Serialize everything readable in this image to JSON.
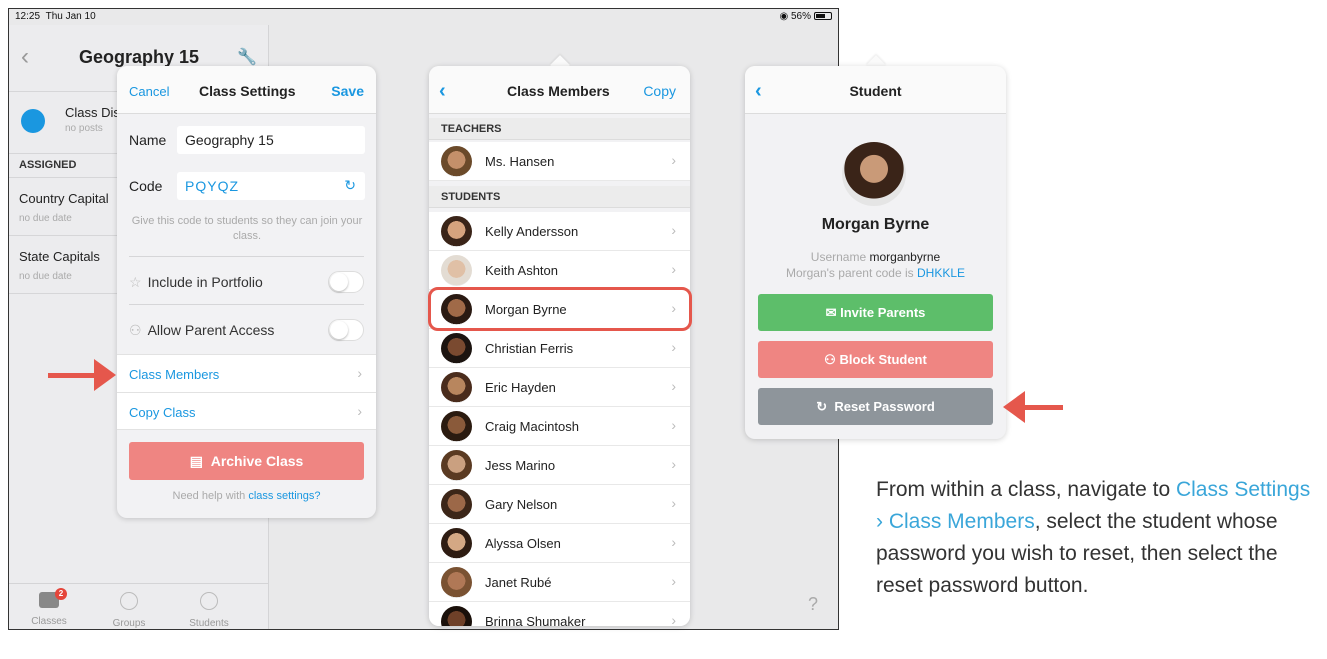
{
  "status_bar": {
    "time": "12:25",
    "date": "Thu Jan 10",
    "battery": "56%"
  },
  "left_pane": {
    "title": "Geography 15",
    "discussion": {
      "title": "Class Dis",
      "subtitle": "no posts"
    },
    "assigned_header": "ASSIGNED",
    "assignments": [
      {
        "title": "Country Capital",
        "due": "no due date"
      },
      {
        "title": "State Capitals",
        "due": "no due date"
      }
    ],
    "tabs": [
      {
        "label": "Classes",
        "badge": "2"
      },
      {
        "label": "Groups"
      },
      {
        "label": "Students"
      }
    ],
    "help": "?"
  },
  "class_settings": {
    "cancel": "Cancel",
    "title": "Class Settings",
    "save": "Save",
    "name_label": "Name",
    "name_value": "Geography 15",
    "code_label": "Code",
    "code_value": "PQYQZ",
    "code_hint": "Give this code to students so they can join your class.",
    "portfolio_label": "Include in Portfolio",
    "parent_access_label": "Allow Parent Access",
    "class_members_link": "Class Members",
    "copy_class_link": "Copy Class",
    "archive_label": "Archive Class",
    "help_prefix": "Need help with",
    "help_link": "class settings?"
  },
  "class_members": {
    "title": "Class Members",
    "copy": "Copy",
    "teachers_header": "TEACHERS",
    "teachers": [
      "Ms. Hansen"
    ],
    "students_header": "STUDENTS",
    "students": [
      "Kelly Andersson",
      "Keith Ashton",
      "Morgan Byrne",
      "Christian Ferris",
      "Eric Hayden",
      "Craig Macintosh",
      "Jess Marino",
      "Gary Nelson",
      "Alyssa Olsen",
      "Janet Rubé",
      "Brinna Shumaker"
    ]
  },
  "student": {
    "title": "Student",
    "name": "Morgan Byrne",
    "username_label": "Username",
    "username": "morganbyrne",
    "parent_code_label": "Morgan's parent code is",
    "parent_code": "DHKKLE",
    "invite_label": "Invite Parents",
    "block_label": "Block Student",
    "reset_label": "Reset Password"
  },
  "caption": {
    "part1": "From within a class, navigate to",
    "link1": "Class Settings",
    "sep": " › ",
    "link2": "Class Members",
    "part2": ", select the student whose password you wish to reset, then select the reset password button."
  },
  "colors": {
    "accent": "#1a97e0",
    "arrow": "#e5574c",
    "green": "#5dbe6a",
    "pink": "#ef8582",
    "gray": "#8e959b"
  }
}
